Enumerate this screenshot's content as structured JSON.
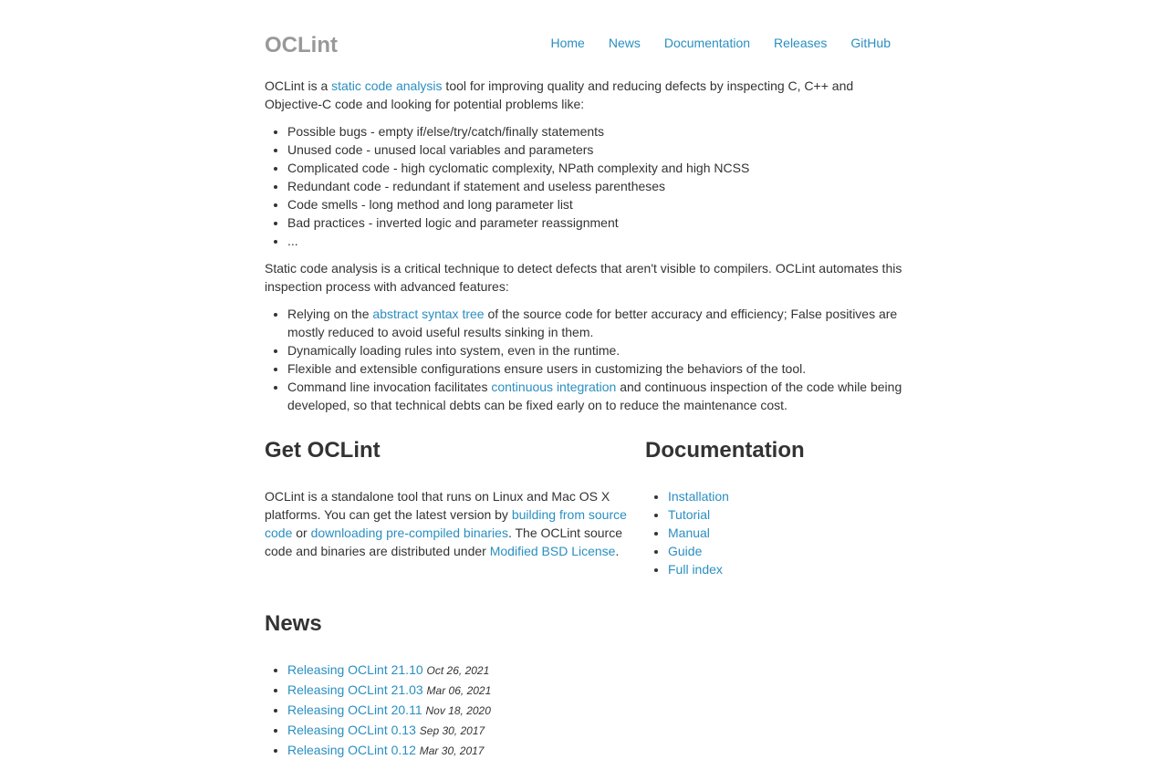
{
  "header": {
    "brand": "OCLint",
    "nav": [
      "Home",
      "News",
      "Documentation",
      "Releases",
      "GitHub"
    ]
  },
  "intro": {
    "p1_before": "OCLint is a ",
    "p1_link": "static code analysis",
    "p1_after": " tool for improving quality and reducing defects by inspecting C, C++ and Objective-C code and looking for potential problems like:",
    "problems": [
      "Possible bugs - empty if/else/try/catch/finally statements",
      "Unused code - unused local variables and parameters",
      "Complicated code - high cyclomatic complexity, NPath complexity and high NCSS",
      "Redundant code - redundant if statement and useless parentheses",
      "Code smells - long method and long parameter list",
      "Bad practices - inverted logic and parameter reassignment",
      "..."
    ],
    "p2": "Static code analysis is a critical technique to detect defects that aren't visible to compilers. OCLint automates this inspection process with advanced features:",
    "feature1_before": "Relying on the ",
    "feature1_link": "abstract syntax tree",
    "feature1_after": " of the source code for better accuracy and efficiency; False positives are mostly reduced to avoid useful results sinking in them.",
    "feature2": "Dynamically loading rules into system, even in the runtime.",
    "feature3": "Flexible and extensible configurations ensure users in customizing the behaviors of the tool.",
    "feature4_before": "Command line invocation facilitates ",
    "feature4_link": "continuous integration",
    "feature4_after": " and continuous inspection of the code while being developed, so that technical debts can be fixed early on to reduce the maintenance cost."
  },
  "get": {
    "title": "Get OCLint",
    "text1": "OCLint is a standalone tool that runs on Linux and Mac OS X platforms. You can get the latest version by ",
    "link1": "building from source code",
    "text2": " or ",
    "link2": "downloading pre-compiled binaries",
    "text3": ". The OCLint source code and binaries are distributed under ",
    "link3": "Modified BSD License",
    "text4": "."
  },
  "docs": {
    "title": "Documentation",
    "links": [
      "Installation",
      "Tutorial",
      "Manual",
      "Guide",
      "Full index"
    ]
  },
  "news": {
    "title": "News",
    "items": [
      {
        "title": "Releasing OCLint 21.10",
        "date": "Oct 26, 2021"
      },
      {
        "title": "Releasing OCLint 21.03",
        "date": "Mar 06, 2021"
      },
      {
        "title": "Releasing OCLint 20.11",
        "date": "Nov 18, 2020"
      },
      {
        "title": "Releasing OCLint 0.13",
        "date": "Sep 30, 2017"
      },
      {
        "title": "Releasing OCLint 0.12",
        "date": "Mar 30, 2017"
      }
    ]
  },
  "colors": {
    "link": "#2a8fc1",
    "brand": "#999999",
    "text": "#333333"
  }
}
